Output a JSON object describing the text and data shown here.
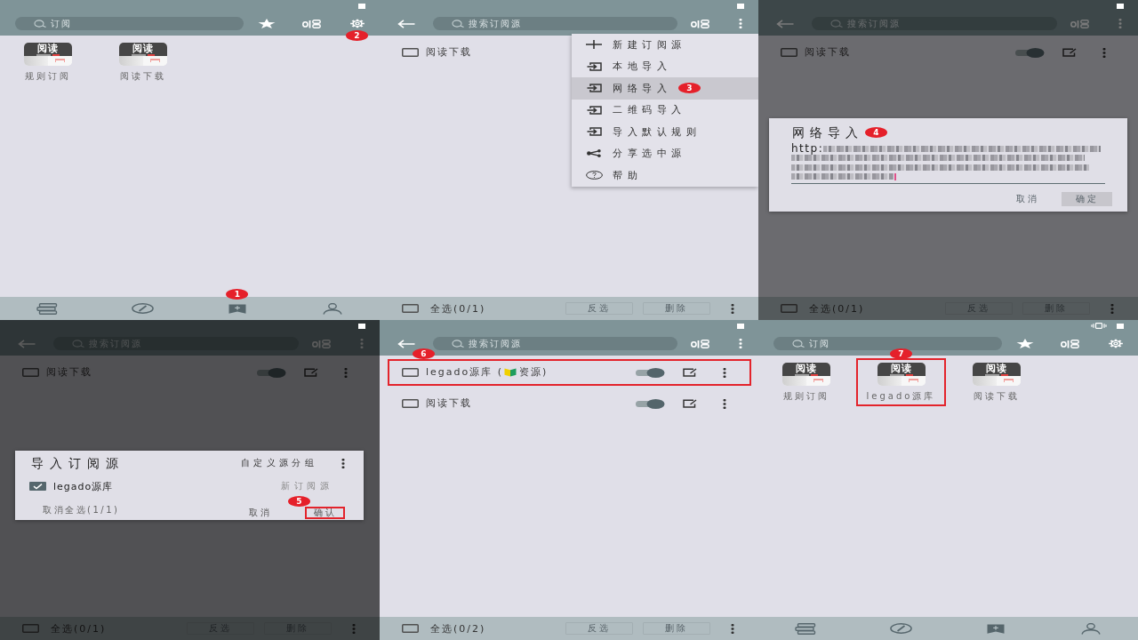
{
  "panels": [
    {
      "kind": "home",
      "status_icons": [
        {
          "kind": "battery"
        }
      ],
      "toolbar": {
        "back": false,
        "search_placeholder": "订阅",
        "actions": [
          {
            "kind": "star"
          },
          {
            "kind": "group"
          },
          {
            "kind": "settings",
            "step": "2"
          }
        ]
      },
      "grid": [
        {
          "icon_text": "阅读",
          "label": "规则订阅",
          "highlighted": false
        },
        {
          "icon_text": "阅读",
          "label": "阅读下载",
          "highlighted": false
        }
      ],
      "nav": [
        {
          "kind": "bookshelf"
        },
        {
          "kind": "discover"
        },
        {
          "kind": "subscription",
          "step": "1"
        },
        {
          "kind": "profile"
        }
      ]
    },
    {
      "kind": "manager",
      "status_icons": [
        {
          "kind": "battery"
        }
      ],
      "toolbar": {
        "back": true,
        "search_placeholder": "搜索订阅源",
        "actions": [
          {
            "kind": "group"
          },
          {
            "kind": "more"
          }
        ]
      },
      "rows": [
        {
          "checked": false,
          "name_parts": [
            {
              "kind": "text",
              "text": "阅读下载"
            }
          ],
          "highlighted": false
        }
      ],
      "footer": {
        "checked": false,
        "label": "全选(0/1)",
        "buttons": [
          {
            "label": "反选",
            "disabled": true
          },
          {
            "label": "删除",
            "disabled": true
          }
        ]
      },
      "menu": {
        "items": [
          {
            "kind": "add",
            "label": "新建订阅源",
            "selected": false
          },
          {
            "kind": "import",
            "label": "本地导入",
            "selected": false
          },
          {
            "kind": "import",
            "label": "网络导入",
            "selected": true,
            "step": "3"
          },
          {
            "kind": "import",
            "label": "二维码导入",
            "selected": false
          },
          {
            "kind": "import",
            "label": "导入默认规则",
            "selected": false
          },
          {
            "kind": "share",
            "label": "分享选中源",
            "selected": false
          },
          {
            "kind": "help",
            "label": "帮助",
            "selected": false
          }
        ]
      }
    },
    {
      "kind": "manager",
      "status_icons": [
        {
          "kind": "battery"
        }
      ],
      "toolbar": {
        "back": true,
        "search_placeholder": "搜索订阅源",
        "actions": [
          {
            "kind": "group"
          },
          {
            "kind": "more"
          }
        ]
      },
      "rows": [
        {
          "checked": false,
          "name_parts": [
            {
              "kind": "text",
              "text": "阅读下载"
            }
          ],
          "enabled": true,
          "highlighted": false
        }
      ],
      "footer": {
        "checked": false,
        "label": "全选(0/1)",
        "buttons": [
          {
            "label": "反选",
            "disabled": true
          },
          {
            "label": "删除",
            "disabled": true
          }
        ]
      },
      "dialog": {
        "kind": "input",
        "title": "网络导入",
        "step": "4",
        "value": "http:",
        "redacted": true,
        "buttons": [
          {
            "label": "取消",
            "pressed": false
          },
          {
            "label": "确定",
            "pressed": true
          }
        ]
      }
    },
    {
      "kind": "manager",
      "status_icons": [
        {
          "kind": "battery"
        }
      ],
      "toolbar": {
        "back": true,
        "search_placeholder": "搜索订阅源",
        "actions": [
          {
            "kind": "group"
          },
          {
            "kind": "more"
          }
        ]
      },
      "rows": [
        {
          "checked": false,
          "name_parts": [
            {
              "kind": "text",
              "text": "阅读下载"
            }
          ],
          "enabled": true,
          "highlighted": false
        }
      ],
      "footer": {
        "checked": false,
        "label": "全选(0/1)",
        "buttons": [
          {
            "label": "反选",
            "disabled": true
          },
          {
            "label": "删除",
            "disabled": true
          }
        ]
      },
      "dialog": {
        "kind": "import",
        "title": "导入订阅源",
        "group_label": "自定义源分组",
        "items": [
          {
            "checked": true,
            "name": "legado源库",
            "status": "新订阅源"
          }
        ],
        "select_label": "取消全选(1/1)",
        "buttons": [
          {
            "label": "取消",
            "highlighted": false
          },
          {
            "label": "确认",
            "highlighted": true,
            "step": "5"
          }
        ]
      }
    },
    {
      "kind": "manager",
      "status_icons": [
        {
          "kind": "battery"
        }
      ],
      "toolbar": {
        "back": true,
        "search_placeholder": "搜索订阅源",
        "actions": [
          {
            "kind": "group"
          },
          {
            "kind": "more"
          }
        ]
      },
      "rows": [
        {
          "checked": false,
          "name_parts": [
            {
              "kind": "text",
              "text": "legado源库 ("
            },
            {
              "kind": "emoji"
            },
            {
              "kind": "text",
              "text": "资源)"
            }
          ],
          "enabled": true,
          "highlighted": true,
          "step": "6"
        },
        {
          "checked": false,
          "name_parts": [
            {
              "kind": "text",
              "text": "阅读下载"
            }
          ],
          "enabled": true,
          "highlighted": false
        }
      ],
      "footer": {
        "checked": false,
        "label": "全选(0/2)",
        "buttons": [
          {
            "label": "反选",
            "disabled": true
          },
          {
            "label": "删除",
            "disabled": true
          }
        ]
      }
    },
    {
      "kind": "home",
      "status_icons": [
        {
          "kind": "vibrate"
        },
        {
          "kind": "battery"
        }
      ],
      "toolbar": {
        "back": false,
        "search_placeholder": "订阅",
        "actions": [
          {
            "kind": "star"
          },
          {
            "kind": "group"
          },
          {
            "kind": "settings"
          }
        ]
      },
      "grid": [
        {
          "icon_text": "阅读",
          "label": "规则订阅",
          "highlighted": false
        },
        {
          "icon_text": "阅读",
          "label": "legado源库",
          "highlighted": true,
          "step": "7"
        },
        {
          "icon_text": "阅读",
          "label": "阅读下载",
          "highlighted": false
        }
      ],
      "nav": [
        {
          "kind": "bookshelf"
        },
        {
          "kind": "discover"
        },
        {
          "kind": "subscription"
        },
        {
          "kind": "profile"
        }
      ]
    }
  ]
}
